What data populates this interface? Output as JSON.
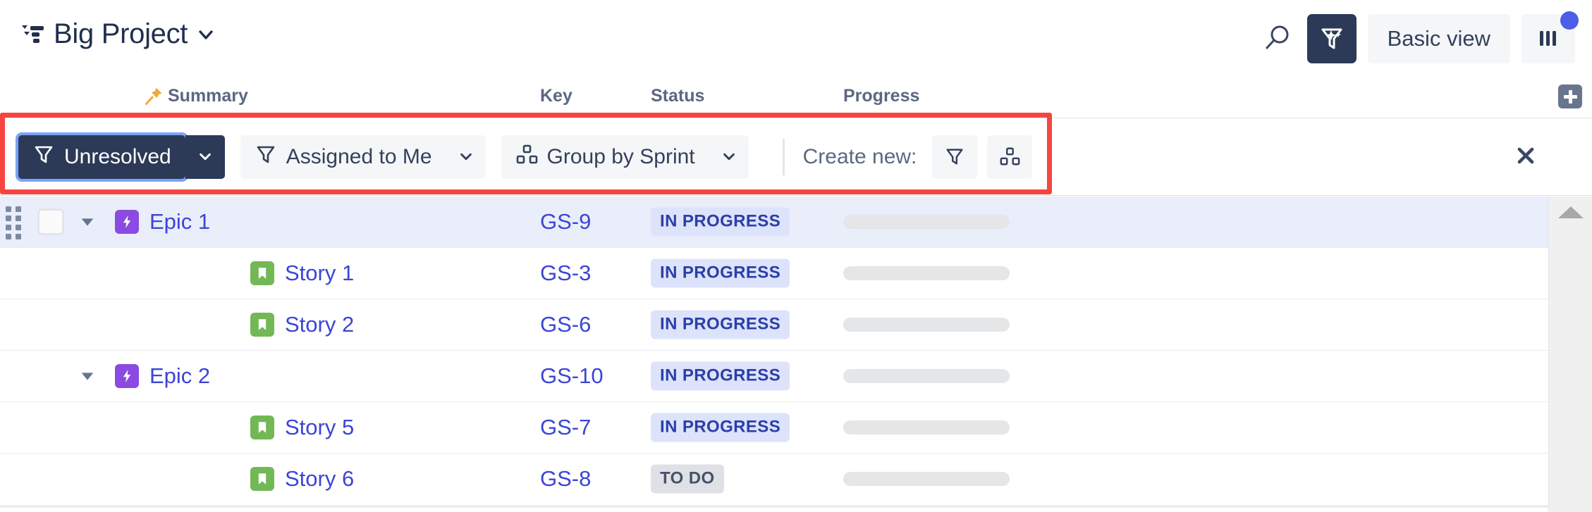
{
  "header": {
    "project_title": "Big Project",
    "hierarchy_icon": "hierarchy-icon",
    "title_caret_icon": "chevron-down-icon",
    "search_icon": "search-icon",
    "magic_filter_icon": "magic-filter-icon",
    "basic_view_label": "Basic view",
    "columns_icon": "columns-icon",
    "notification_dot": true
  },
  "columns": {
    "pin_icon": "pin-icon",
    "summary": "Summary",
    "key": "Key",
    "status": "Status",
    "progress": "Progress",
    "add_column_icon": "plus-icon"
  },
  "filter_bar": {
    "highlighted": true,
    "highlight_color": "#f64541",
    "filters": [
      {
        "label": "Unresolved",
        "icon": "filter-icon",
        "active": true,
        "caret_icon": "chevron-down-icon"
      },
      {
        "label": "Assigned to Me",
        "icon": "filter-icon",
        "active": false,
        "caret_icon": "chevron-down-icon"
      },
      {
        "label": "Group by Sprint",
        "icon": "group-icon",
        "active": false,
        "caret_icon": "chevron-down-icon"
      }
    ],
    "create_new_label": "Create new:",
    "create_buttons": [
      {
        "icon": "filter-icon",
        "name": "create-new-filter-button"
      },
      {
        "icon": "group-icon",
        "name": "create-new-group-button"
      }
    ],
    "close_icon": "close-icon"
  },
  "rows": [
    {
      "summary": "Epic 1",
      "type": "epic",
      "key": "GS-9",
      "status": "IN PROGRESS",
      "status_tone": "inprogress",
      "progress": 0,
      "indent": 163,
      "expander": true,
      "expanded": true,
      "selected": true,
      "checkbox": true,
      "drag_handle": true
    },
    {
      "summary": "Story 1",
      "type": "story",
      "key": "GS-3",
      "status": "IN PROGRESS",
      "status_tone": "inprogress",
      "progress": 0,
      "indent": 355,
      "expander": false,
      "expanded": false,
      "selected": false,
      "checkbox": false,
      "drag_handle": false
    },
    {
      "summary": "Story 2",
      "type": "story",
      "key": "GS-6",
      "status": "IN PROGRESS",
      "status_tone": "inprogress",
      "progress": 0,
      "indent": 355,
      "expander": false,
      "expanded": false,
      "selected": false,
      "checkbox": false,
      "drag_handle": false
    },
    {
      "summary": "Epic 2",
      "type": "epic",
      "key": "GS-10",
      "status": "IN PROGRESS",
      "status_tone": "inprogress",
      "progress": 0,
      "indent": 163,
      "expander": true,
      "expanded": true,
      "selected": false,
      "checkbox": false,
      "drag_handle": false
    },
    {
      "summary": "Story 5",
      "type": "story",
      "key": "GS-7",
      "status": "IN PROGRESS",
      "status_tone": "inprogress",
      "progress": 0,
      "indent": 355,
      "expander": false,
      "expanded": false,
      "selected": false,
      "checkbox": false,
      "drag_handle": false
    },
    {
      "summary": "Story 6",
      "type": "story",
      "key": "GS-8",
      "status": "TO DO",
      "status_tone": "todo",
      "progress": 0,
      "indent": 355,
      "expander": false,
      "expanded": false,
      "selected": false,
      "checkbox": false,
      "drag_handle": false
    }
  ],
  "scrollbar": {
    "up_arrow_icon": "scroll-up-arrow-icon"
  },
  "colors": {
    "accent_link": "#3b45d6",
    "dark_button": "#2c3a57",
    "epic_purple": "#8b4ae2",
    "story_green": "#72b855",
    "status_inprogress_bg": "#dde3fb",
    "status_todo_bg": "#dfe1e6",
    "highlight_row": "#eaeefb",
    "notification_blue": "#4c5ee8",
    "pin_orange": "#f2a73b"
  }
}
